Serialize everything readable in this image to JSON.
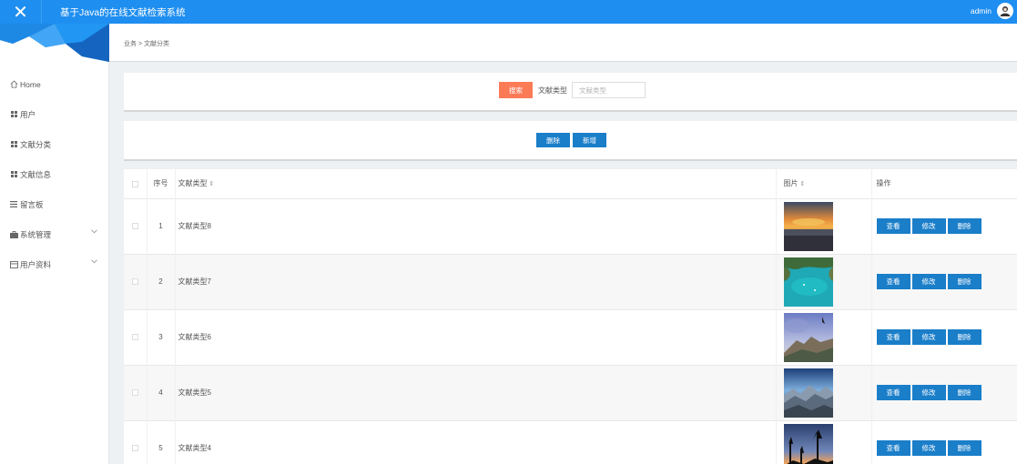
{
  "header": {
    "title": "基于Java的在线文献检索系统",
    "username": "admin",
    "close_icon": "close-icon",
    "accent": "#1e8ef0"
  },
  "sidebar": {
    "items": [
      {
        "label": "Home",
        "icon": "home-icon"
      },
      {
        "label": "用户",
        "icon": "grid-icon"
      },
      {
        "label": "文献分类",
        "icon": "grid-icon"
      },
      {
        "label": "文献信息",
        "icon": "grid-icon"
      },
      {
        "label": "留言板",
        "icon": "list-icon"
      },
      {
        "label": "系统管理",
        "icon": "briefcase-icon",
        "expandable": true
      },
      {
        "label": "用户资料",
        "icon": "card-icon",
        "expandable": true
      }
    ]
  },
  "breadcrumb": "业务 > 文献分类",
  "search": {
    "button_label": "搜索",
    "field_label": "文献类型",
    "placeholder": "文献类型",
    "value": "",
    "button_color": "#fb7b57"
  },
  "actions": {
    "delete_label": "删除",
    "add_label": "新增",
    "button_color": "#1a7ec9"
  },
  "table": {
    "columns": {
      "index": "序号",
      "type": "文献类型",
      "image": "图片",
      "ops": "操作"
    },
    "row_buttons": {
      "view": "查看",
      "edit": "修改",
      "delete": "删除"
    },
    "rows": [
      {
        "index": "1",
        "type": "文献类型8",
        "image": "sunset-sea-image"
      },
      {
        "index": "2",
        "type": "文献类型7",
        "image": "lagoon-image"
      },
      {
        "index": "3",
        "type": "文献类型6",
        "image": "mountain-clouds-image"
      },
      {
        "index": "4",
        "type": "文献类型5",
        "image": "mountain-range-image"
      },
      {
        "index": "5",
        "type": "文献类型4",
        "image": "forest-sunset-image"
      }
    ]
  }
}
